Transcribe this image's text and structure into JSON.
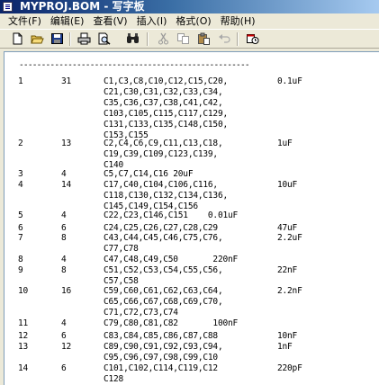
{
  "window": {
    "title": "MYPROJ.BOM - 写字板"
  },
  "menu": [
    {
      "label": "文件(F)"
    },
    {
      "label": "编辑(E)"
    },
    {
      "label": "查看(V)"
    },
    {
      "label": "插入(I)"
    },
    {
      "label": "格式(O)"
    },
    {
      "label": "帮助(H)"
    }
  ],
  "toolbar": {
    "icons": [
      "new-icon",
      "open-icon",
      "save-icon",
      "print-icon",
      "print-preview-icon",
      "find-icon",
      "cut-icon",
      "copy-icon",
      "paste-icon",
      "undo-icon",
      "datetime-icon"
    ]
  },
  "document": {
    "separator": "----------------------------------------------------",
    "rows": [
      {
        "item": "1",
        "qty": "31",
        "lines": [
          "C1,C3,C8,C10,C12,C15,C20,",
          "C21,C30,C31,C32,C33,C34,",
          "C35,C36,C37,C38,C41,C42,",
          "C103,C105,C115,C117,C129,",
          "C131,C133,C135,C148,C150,",
          "C153,C155"
        ],
        "value": "0.1uF"
      },
      {
        "item": "2",
        "qty": "13",
        "lines": [
          "C2,C4,C6,C9,C11,C13,C18,",
          "C19,C39,C109,C123,C139,",
          "C140"
        ],
        "value": "1uF"
      },
      {
        "item": "3",
        "qty": "4",
        "lines": [
          "C5,C7,C14,C16 20uF"
        ],
        "value": ""
      },
      {
        "item": "4",
        "qty": "14",
        "lines": [
          "C17,C40,C104,C106,C116,",
          "C118,C130,C132,C134,C136,",
          "C145,C149,C154,C156"
        ],
        "value": "10uF"
      },
      {
        "item": "5",
        "qty": "4",
        "lines": [
          "C22,C23,C146,C151    0.01uF"
        ],
        "value": ""
      },
      {
        "item": "6",
        "qty": "6",
        "lines": [
          "C24,C25,C26,C27,C28,C29"
        ],
        "value": "47uF"
      },
      {
        "item": "7",
        "qty": "8",
        "lines": [
          "C43,C44,C45,C46,C75,C76,",
          "C77,C78"
        ],
        "value": "2.2uF"
      },
      {
        "item": "8",
        "qty": "4",
        "lines": [
          "C47,C48,C49,C50       220nF"
        ],
        "value": ""
      },
      {
        "item": "9",
        "qty": "8",
        "lines": [
          "C51,C52,C53,C54,C55,C56,",
          "C57,C58"
        ],
        "value": "22nF"
      },
      {
        "item": "10",
        "qty": "16",
        "lines": [
          "C59,C60,C61,C62,C63,C64,",
          "C65,C66,C67,C68,C69,C70,",
          "C71,C72,C73,C74"
        ],
        "value": "2.2nF"
      },
      {
        "item": "11",
        "qty": "4",
        "lines": [
          "C79,C80,C81,C82       100nF"
        ],
        "value": ""
      },
      {
        "item": "12",
        "qty": "6",
        "lines": [
          "C83,C84,C85,C86,C87,C88"
        ],
        "value": "10nF"
      },
      {
        "item": "13",
        "qty": "12",
        "lines": [
          "C89,C90,C91,C92,C93,C94,",
          "C95,C96,C97,C98,C99,C10"
        ],
        "value": "1nF"
      },
      {
        "item": "14",
        "qty": "6",
        "lines": [
          "C101,C102,C114,C119,C12",
          "C128"
        ],
        "value": "220pF"
      }
    ]
  },
  "colors": {
    "titlebar_start": "#0a246a",
    "titlebar_end": "#a6caf0",
    "chrome": "#ece9d8",
    "paper": "#ffffff"
  }
}
